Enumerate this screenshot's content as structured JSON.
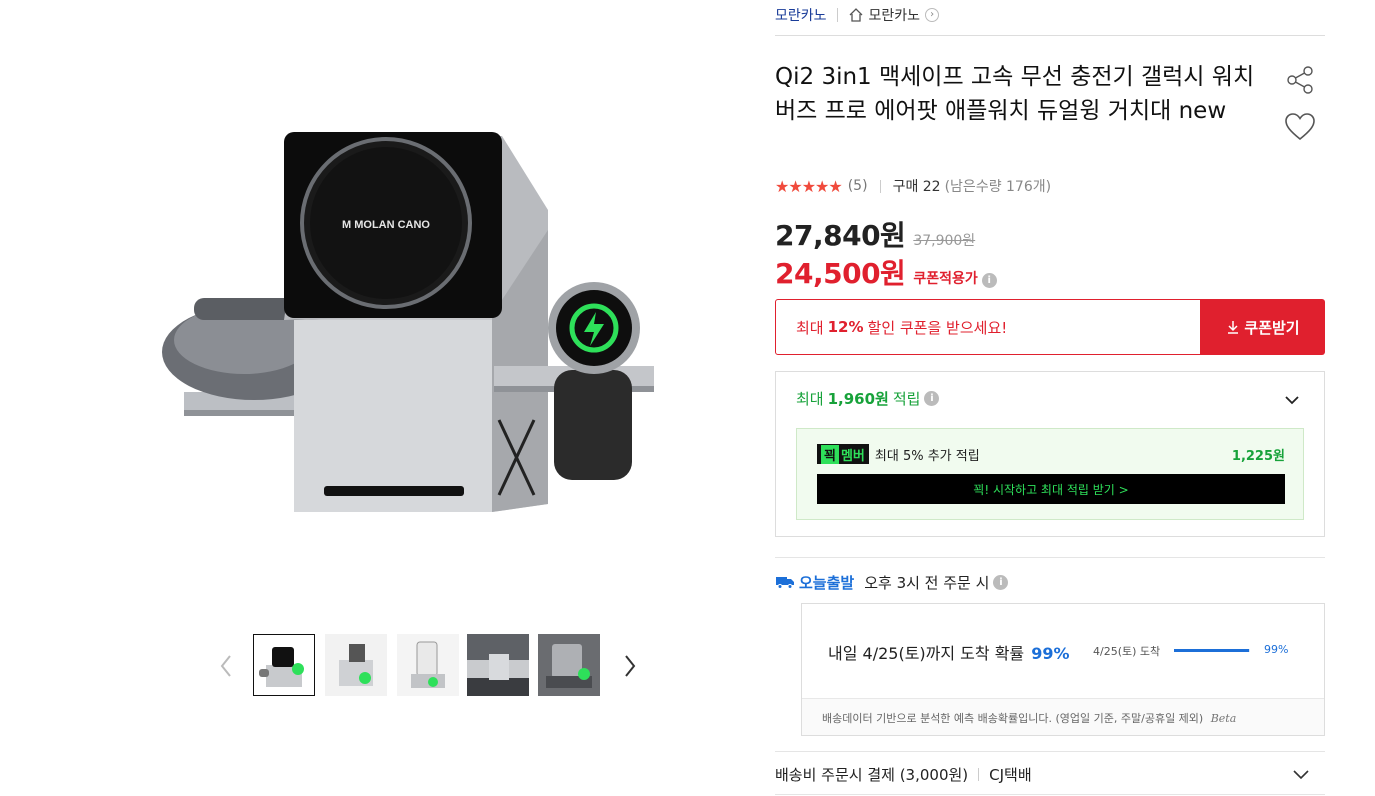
{
  "gallery": {
    "main_image_icon": "charger-product-image",
    "main_logo": "M MOLAN CANO",
    "thumbnails": [
      {
        "icon": "thumbnail-charger-front",
        "active": true
      },
      {
        "icon": "thumbnail-charger-side",
        "active": false
      },
      {
        "icon": "thumbnail-charger-phone",
        "active": false
      },
      {
        "icon": "thumbnail-charger-desk",
        "active": false
      },
      {
        "icon": "thumbnail-charger-dark",
        "active": false
      }
    ]
  },
  "breadcrumb": {
    "seller": "모란카노",
    "store": "모란카노"
  },
  "product": {
    "title": "Qi2 3in1 맥세이프 고속 무선 충전기 갤럭시 워치 버즈 프로 에어팟 애플워치 듀얼윙 거치대 new",
    "stars": "★★★★★",
    "review_count": "(5)",
    "purchase": "구매 22",
    "remaining": "(남은수량 176개)"
  },
  "price": {
    "current": "27,840원",
    "original": "37,900원",
    "coupon_price": "24,500원",
    "coupon_label": "쿠폰적용가"
  },
  "coupon": {
    "prefix": "최대",
    "percent": "12%",
    "suffix": "할인 쿠폰을 받으세요!",
    "button_label": "쿠폰받기"
  },
  "points": {
    "prefix": "최대",
    "amount": "1,960원",
    "suffix": "적립",
    "member_badge_a": "꾁",
    "member_badge_b": "멤버",
    "member_text": "최대 5% 추가 적립",
    "member_amount": "1,225원",
    "member_cta": "꾁! 시작하고 최대 적립 받기 >"
  },
  "delivery": {
    "today_label": "오늘출발",
    "today_text": "오후 3시 전 주문 시",
    "arrive_text": "내일 4/25(토)까지 도착 확률",
    "arrive_pct": "99%",
    "mini_date": "4/25(토) 도착",
    "mini_pct": "99%",
    "probability": 0.99,
    "note": "배송데이터 기반으로 분석한 예측 배송확률입니다. (영업일 기준, 주말/공휴일 제외)",
    "beta": "Beta"
  },
  "shipping": {
    "fee": "배송비 주문시 결제 (3,000원)",
    "carrier": "CJ택배"
  },
  "colors": {
    "accent_red": "#e0202e",
    "accent_blue": "#1c6fd8",
    "accent_green": "#17a23a",
    "member_green": "#2ee05a"
  }
}
